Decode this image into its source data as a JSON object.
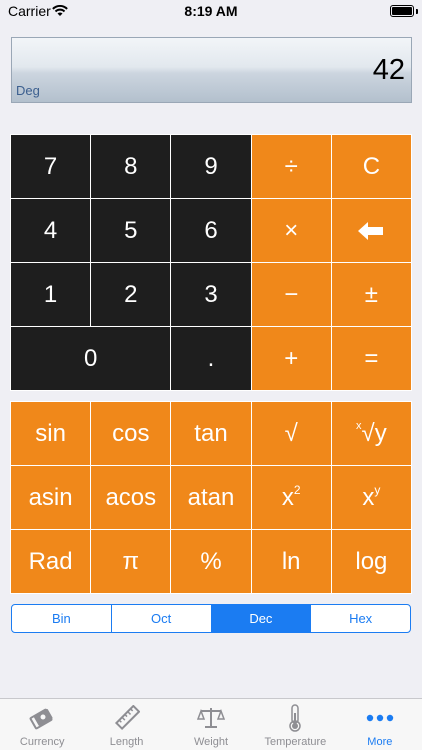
{
  "status": {
    "carrier": "Carrier",
    "time": "8:19 AM"
  },
  "display": {
    "value": "42",
    "mode": "Deg"
  },
  "keypad": {
    "keys": [
      "7",
      "8",
      "9",
      "÷",
      "C",
      "4",
      "5",
      "6",
      "×",
      "⬅",
      "1",
      "2",
      "3",
      "−",
      "±",
      "0",
      ".",
      "+",
      "="
    ]
  },
  "scientific": {
    "keys": [
      "sin",
      "cos",
      "tan",
      "√",
      "y",
      "asin",
      "acos",
      "atan",
      "x",
      "x",
      "Rad",
      "π",
      "%",
      "ln",
      "log"
    ],
    "sqrt_prefix": "x",
    "square_exp": "2",
    "power_exp": "y"
  },
  "base": {
    "options": [
      "Bin",
      "Oct",
      "Dec",
      "Hex"
    ],
    "selected": "Dec"
  },
  "tabs": [
    {
      "label": "Currency",
      "icon": "currency-icon"
    },
    {
      "label": "Length",
      "icon": "ruler-icon"
    },
    {
      "label": "Weight",
      "icon": "scale-icon"
    },
    {
      "label": "Temperature",
      "icon": "thermometer-icon"
    },
    {
      "label": "More",
      "icon": "more-icon"
    }
  ],
  "colors": {
    "orange": "#f0881a",
    "dark_key": "#1e1e1e",
    "accent": "#1b7cf2"
  }
}
